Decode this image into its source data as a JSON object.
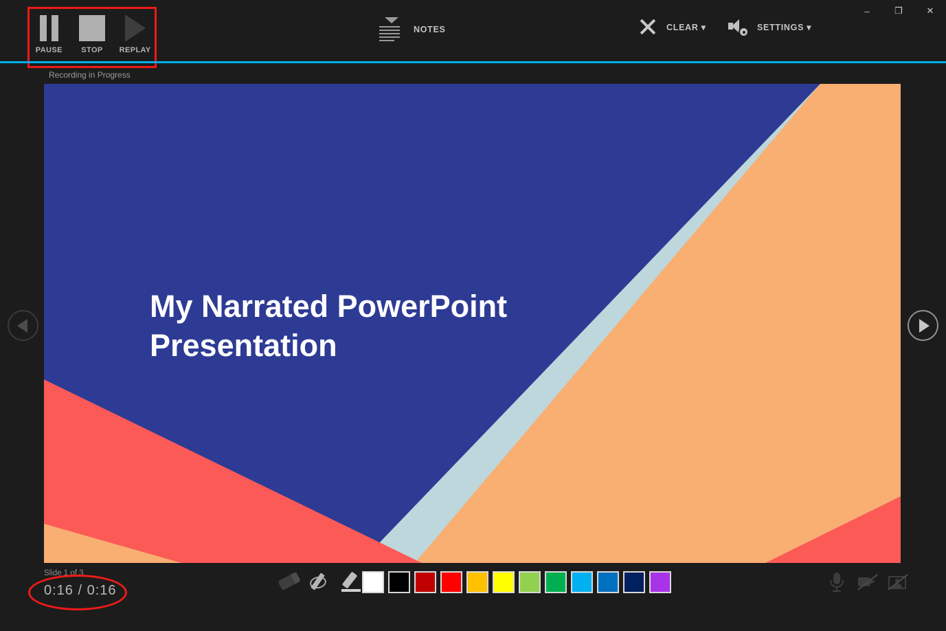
{
  "window": {
    "minimize_label": "–",
    "restore_label": "❐",
    "close_label": "✕"
  },
  "toolbar": {
    "transport": [
      {
        "id": "pause",
        "label": "PAUSE",
        "icon": "pause-icon",
        "state": "enabled"
      },
      {
        "id": "stop",
        "label": "STOP",
        "icon": "stop-icon",
        "state": "enabled"
      },
      {
        "id": "replay",
        "label": "REPLAY",
        "icon": "play-icon",
        "state": "disabled"
      }
    ],
    "notes_label": "NOTES",
    "clear_label": "CLEAR ▾",
    "settings_label": "SETTINGS ▾"
  },
  "status": {
    "recording_text": "Recording in Progress",
    "accent_color": "#00aee6",
    "annotation_color": "#ee1b18"
  },
  "slide": {
    "title": "My Narrated PowerPoint Presentation",
    "counter": "Slide 1 of 3",
    "timer": "0:16 / 0:16",
    "colors": {
      "light_blue": "#bdd7dc",
      "navy": "#2e3b94",
      "orange": "#f9ae72",
      "red": "#fb5a57"
    }
  },
  "navigation": {
    "previous_label": "Previous slide",
    "next_label": "Next slide"
  },
  "pen_tools": [
    {
      "id": "eraser",
      "name": "eraser-icon",
      "state": "inactive"
    },
    {
      "id": "pen",
      "name": "pen-icon",
      "state": "active"
    },
    {
      "id": "highlighter",
      "name": "highlighter-icon",
      "state": "active"
    }
  ],
  "ink_colors": [
    {
      "name": "white",
      "hex": "#ffffff"
    },
    {
      "name": "black",
      "hex": "#000000"
    },
    {
      "name": "dark-red",
      "hex": "#c00000"
    },
    {
      "name": "red",
      "hex": "#ff0000"
    },
    {
      "name": "amber",
      "hex": "#ffc000"
    },
    {
      "name": "yellow",
      "hex": "#ffff00"
    },
    {
      "name": "light-green",
      "hex": "#92d050"
    },
    {
      "name": "green",
      "hex": "#00b050"
    },
    {
      "name": "light-blue",
      "hex": "#00b0f0"
    },
    {
      "name": "blue",
      "hex": "#0070c0"
    },
    {
      "name": "dark-blue",
      "hex": "#002060"
    },
    {
      "name": "purple",
      "hex": "#a933e8"
    }
  ],
  "devices": [
    {
      "id": "microphone",
      "name": "microphone-icon",
      "state": "on"
    },
    {
      "id": "camera",
      "name": "camera-off-icon",
      "state": "off"
    },
    {
      "id": "preview",
      "name": "preview-off-icon",
      "state": "off"
    }
  ]
}
